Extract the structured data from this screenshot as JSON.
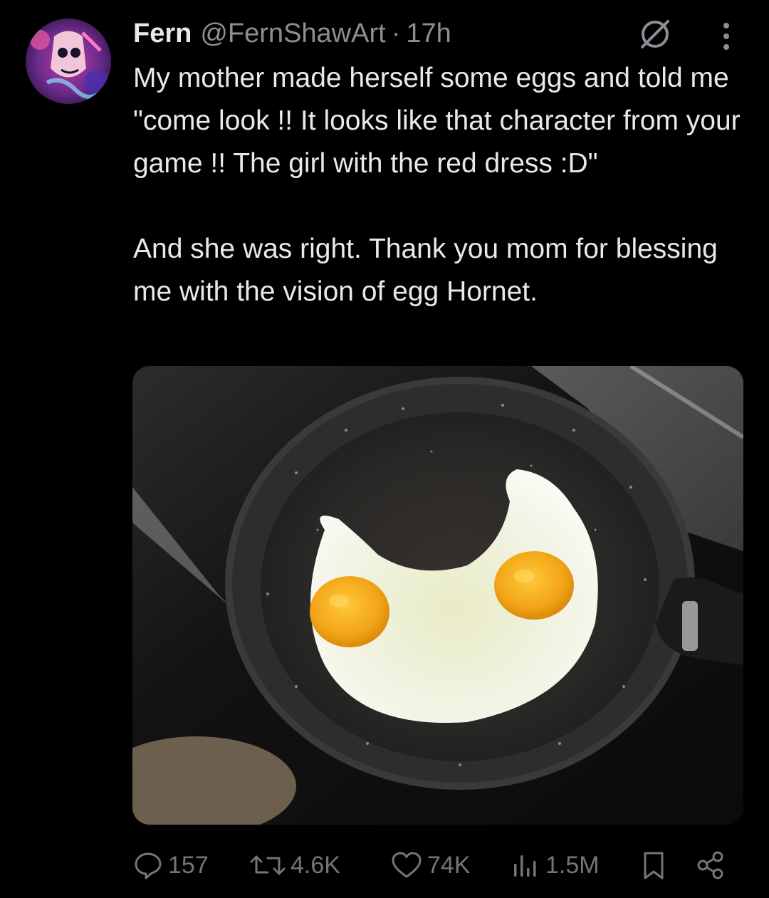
{
  "tweet": {
    "author_name": "Fern",
    "handle": "@FernShawArt",
    "separator": "·",
    "timestamp": "17h",
    "text_paragraphs": [
      "My mother made herself some eggs and told me \"come look !! It looks like that character from your game !! The girl with the red dress :D\"",
      "And she was right. Thank you mom for blessing me with the vision of egg Hornet."
    ]
  },
  "icons": {
    "header": [
      "grok-icon",
      "more-options-icon"
    ],
    "actions": [
      "reply-icon",
      "retweet-icon",
      "like-icon",
      "views-icon",
      "bookmark-icon",
      "share-icon"
    ]
  },
  "metrics": {
    "replies": "157",
    "retweets": "4.6K",
    "likes": "74K",
    "views": "1.5M"
  },
  "colors": {
    "background": "#000000",
    "text_primary": "#e7e9ea",
    "text_secondary": "#71767b",
    "egg_yolk": "#f2a516"
  }
}
